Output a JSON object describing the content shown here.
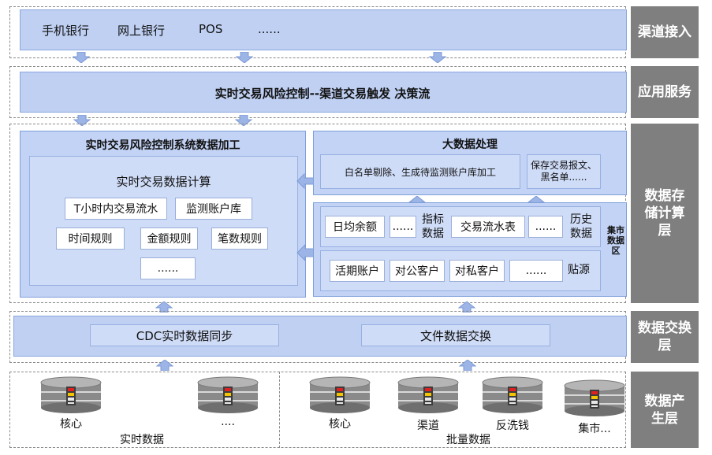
{
  "layers": {
    "channel": "渠道接入",
    "app": "应用服务",
    "storage": "数据存储计算层",
    "exchange": "数据交换层",
    "produce": "数据产生层"
  },
  "channel": {
    "items": [
      "手机银行",
      "网上银行",
      "POS",
      "......"
    ]
  },
  "app": {
    "title": "实时交易风险控制--渠道交易触发 决策流"
  },
  "processing": {
    "title": "实时交易风险控制系统数据加工",
    "calc_title": "实时交易数据计算",
    "row1": [
      "T小时内交易流水",
      "监测账户库"
    ],
    "row2": [
      "时间规则",
      "金额规则",
      "笔数规则"
    ],
    "row3": "......"
  },
  "bigdata": {
    "title": "大数据处理",
    "task1": "白名单剔除、生成待监测账户库加工",
    "task2": "保存交易报文、黑名单......"
  },
  "mart": {
    "label": "集市数据区",
    "indicator_items": [
      "日均余额",
      "......"
    ],
    "indicator_label": "指标数据",
    "history_items": [
      "交易流水表",
      "......"
    ],
    "history_label": "历史数据",
    "source_items": [
      "活期账户",
      "对公客户",
      "对私客户",
      "......"
    ],
    "source_label": "贴源"
  },
  "exchange": {
    "cdc": "CDC实时数据同步",
    "file": "文件数据交换"
  },
  "produce": {
    "realtime_dbs": [
      "核心",
      "...."
    ],
    "realtime_label": "实时数据",
    "batch_dbs": [
      "核心",
      "渠道",
      "反洗钱",
      "集市..."
    ],
    "batch_label": "批量数据"
  }
}
